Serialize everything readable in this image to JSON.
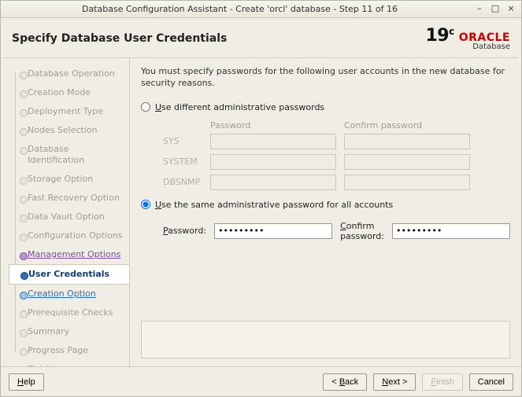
{
  "window": {
    "title": "Database Configuration Assistant - Create 'orcl' database - Step 11 of 16"
  },
  "header": {
    "title": "Specify Database User Credentials",
    "brand": {
      "version": "19",
      "version_suffix": "c",
      "oracle": "ORACLE",
      "database": "Database"
    }
  },
  "sidebar": {
    "steps": [
      {
        "label": "Database Operation",
        "state": "past"
      },
      {
        "label": "Creation Mode",
        "state": "past"
      },
      {
        "label": "Deployment Type",
        "state": "past"
      },
      {
        "label": "Nodes Selection",
        "state": "past"
      },
      {
        "label": "Database Identification",
        "state": "past"
      },
      {
        "label": "Storage Option",
        "state": "past"
      },
      {
        "label": "Fast Recovery Option",
        "state": "past"
      },
      {
        "label": "Data Vault Option",
        "state": "past"
      },
      {
        "label": "Configuration Options",
        "state": "past"
      },
      {
        "label": "Management Options",
        "state": "visited"
      },
      {
        "label": "User Credentials",
        "state": "current"
      },
      {
        "label": "Creation Option",
        "state": "upcoming"
      },
      {
        "label": "Prerequisite Checks",
        "state": "future"
      },
      {
        "label": "Summary",
        "state": "future"
      },
      {
        "label": "Progress Page",
        "state": "future"
      },
      {
        "label": "Finish",
        "state": "future"
      }
    ]
  },
  "content": {
    "lead": "You must specify passwords for the following user accounts in the new database for security reasons.",
    "radio_different": {
      "ul": "U",
      "rest": "se different administrative passwords"
    },
    "radio_same": {
      "ul": "U",
      "rest": "se the same administrative password for all accounts"
    },
    "grid": {
      "headers": {
        "password": "Password",
        "confirm": "Confirm password"
      },
      "rows": [
        {
          "label": "SYS"
        },
        {
          "label": "SYSTEM"
        },
        {
          "label": "DBSNMP"
        }
      ]
    },
    "same": {
      "password_label": {
        "ul": "P",
        "rest": "assword:"
      },
      "confirm_label": {
        "ul": "C",
        "rest": "onfirm password:"
      },
      "password_value": "•••••••••",
      "confirm_value": "•••••••••"
    }
  },
  "footer": {
    "help": {
      "ul": "H",
      "rest": "elp"
    },
    "back": {
      "pre": "< ",
      "ul": "B",
      "rest": "ack"
    },
    "next": {
      "ul": "N",
      "rest": "ext >"
    },
    "finish": {
      "ul": "F",
      "rest": "inish"
    },
    "cancel": "Cancel"
  }
}
